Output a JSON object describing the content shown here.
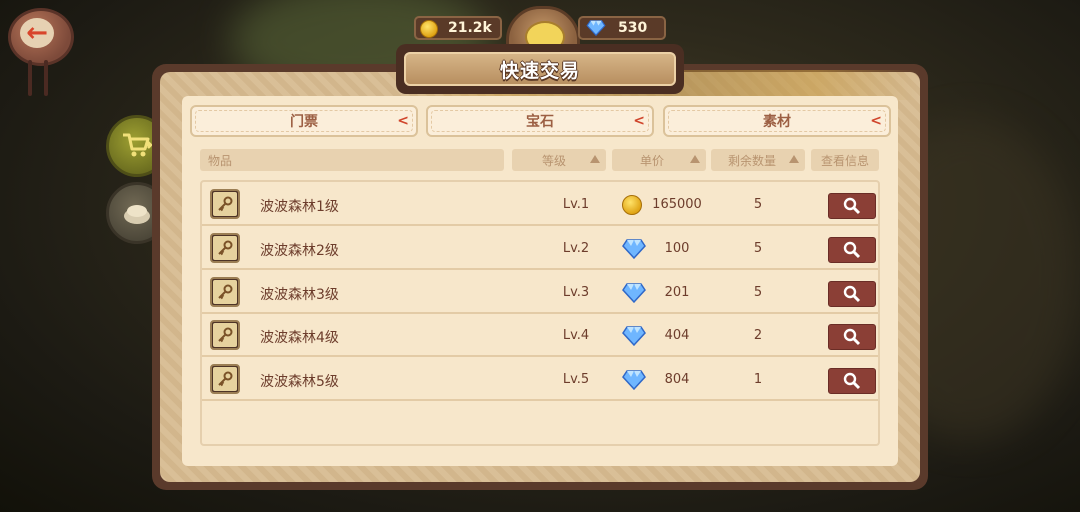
{
  "currency": {
    "coins": "21.2k",
    "gems": "530"
  },
  "title": "快速交易",
  "tabs": [
    {
      "label": "门票",
      "chevron": "<"
    },
    {
      "label": "宝石",
      "chevron": "<"
    },
    {
      "label": "素材",
      "chevron": "<"
    }
  ],
  "columns": {
    "item": "物品",
    "level": "等级",
    "price": "单价",
    "remaining": "剩余数量",
    "view": "查看信息"
  },
  "rows": [
    {
      "name": "波波森林1级",
      "level": "Lv.1",
      "currency_icon": "coin-icon",
      "price": "165000",
      "qty": "5"
    },
    {
      "name": "波波森林2级",
      "level": "Lv.2",
      "currency_icon": "diamond-icon",
      "price": "100",
      "qty": "5"
    },
    {
      "name": "波波森林3级",
      "level": "Lv.3",
      "currency_icon": "diamond-icon",
      "price": "201",
      "qty": "5"
    },
    {
      "name": "波波森林4级",
      "level": "Lv.4",
      "currency_icon": "diamond-icon",
      "price": "404",
      "qty": "2"
    },
    {
      "name": "波波森林5级",
      "level": "Lv.5",
      "currency_icon": "diamond-icon",
      "price": "804",
      "qty": "1"
    }
  ],
  "side_buttons": [
    "shop-cart-icon",
    "backpack-icon"
  ],
  "colors": {
    "accent_red": "#d0452c",
    "button_maroon": "#8b3f36",
    "panel_cream": "#f7e7cb",
    "text_brown": "#6d3d2c"
  }
}
